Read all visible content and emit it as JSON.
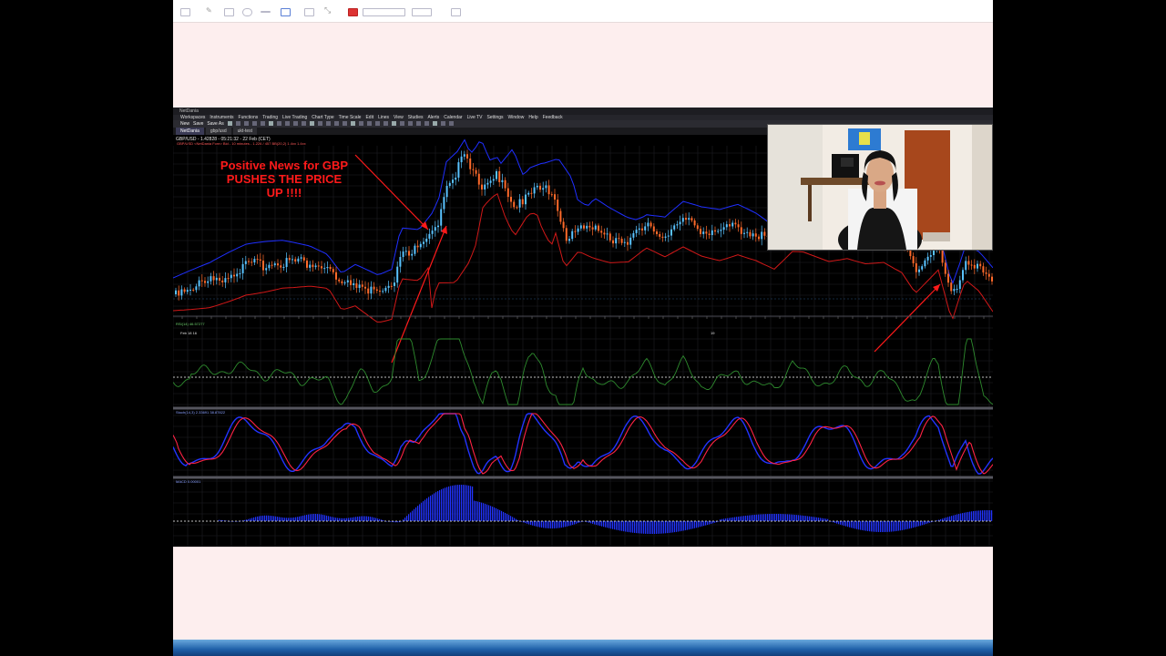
{
  "app": {
    "title": "NetDania",
    "menu": [
      "Workspaces",
      "Instruments",
      "Functions",
      "Trading",
      "Live Trading",
      "Chart Type",
      "Time Scale",
      "Edit",
      "Lines",
      "View",
      "Studies",
      "Alerts",
      "Calendar",
      "Live TV",
      "Settings",
      "Window",
      "Help",
      "Feedback"
    ],
    "toolbar": [
      "New",
      "Save",
      "Save As"
    ],
    "tabs": [
      "NetDania",
      "gbp/usd",
      "ukt-test"
    ]
  },
  "chart": {
    "symbol_line": "GBP/USD - 1.42828 - 05:21:32 - 22 Feb (CET)",
    "date_left": "Feb 18 16",
    "date_mid": "19",
    "annotation": [
      "Positive News for GBP",
      "PUSHES THE PRICE",
      "UP !!!!"
    ]
  },
  "colors": {
    "up_candle": "#59c3ff",
    "down_candle": "#ff6a2a",
    "band_upper": "#1f2fff",
    "band_lower": "#d01818",
    "rsi": "#2e8b2e",
    "stoch_k": "#2233ff",
    "stoch_d": "#ff2244",
    "histogram": "#2233ff",
    "annotation": "#ff1a1a"
  }
}
